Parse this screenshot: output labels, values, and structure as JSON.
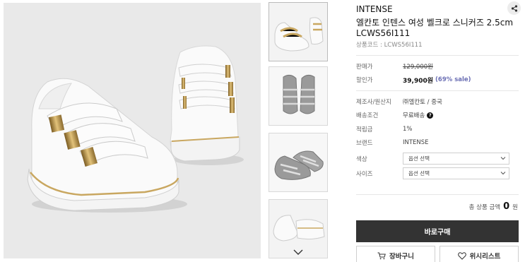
{
  "product": {
    "brand": "INTENSE",
    "name": "엘칸토 인텐스 여성 벨크로 스니커즈 2.5cm",
    "model": "LCWS56I111",
    "code_label": "상품코드",
    "code_value": "LCWS56I111"
  },
  "price": {
    "list_label": "판매가",
    "list_value": "129,000원",
    "sale_label": "할인가",
    "sale_value": "39,900원",
    "sale_rate": "(69% sale)"
  },
  "details": [
    {
      "label": "제조사/원산지",
      "value": "㈜엘칸토 / 중국"
    },
    {
      "label": "배송조건",
      "value": "무료배송",
      "info_icon": "?"
    },
    {
      "label": "적립금",
      "value": "1%"
    },
    {
      "label": "브랜드",
      "value": "INTENSE"
    }
  ],
  "options": [
    {
      "label": "색상",
      "placeholder": "옵션 선택"
    },
    {
      "label": "사이즈",
      "placeholder": "옵션 선택"
    }
  ],
  "total": {
    "label": "총 상품 금액",
    "amount": "0",
    "unit": "원"
  },
  "buttons": {
    "buy_now": "바로구매",
    "cart": "장바구니",
    "wishlist": "위시리스트"
  },
  "icons": {
    "share": "share-icon",
    "thumb_up": "chevron-up-icon",
    "thumb_down": "chevron-down-icon",
    "cart": "cart-icon",
    "wishlist": "heart-icon"
  },
  "colors": {
    "primary_button": "#333333",
    "sale_rate": "#6b6fb4",
    "image_bg": "#e9e9e9"
  }
}
